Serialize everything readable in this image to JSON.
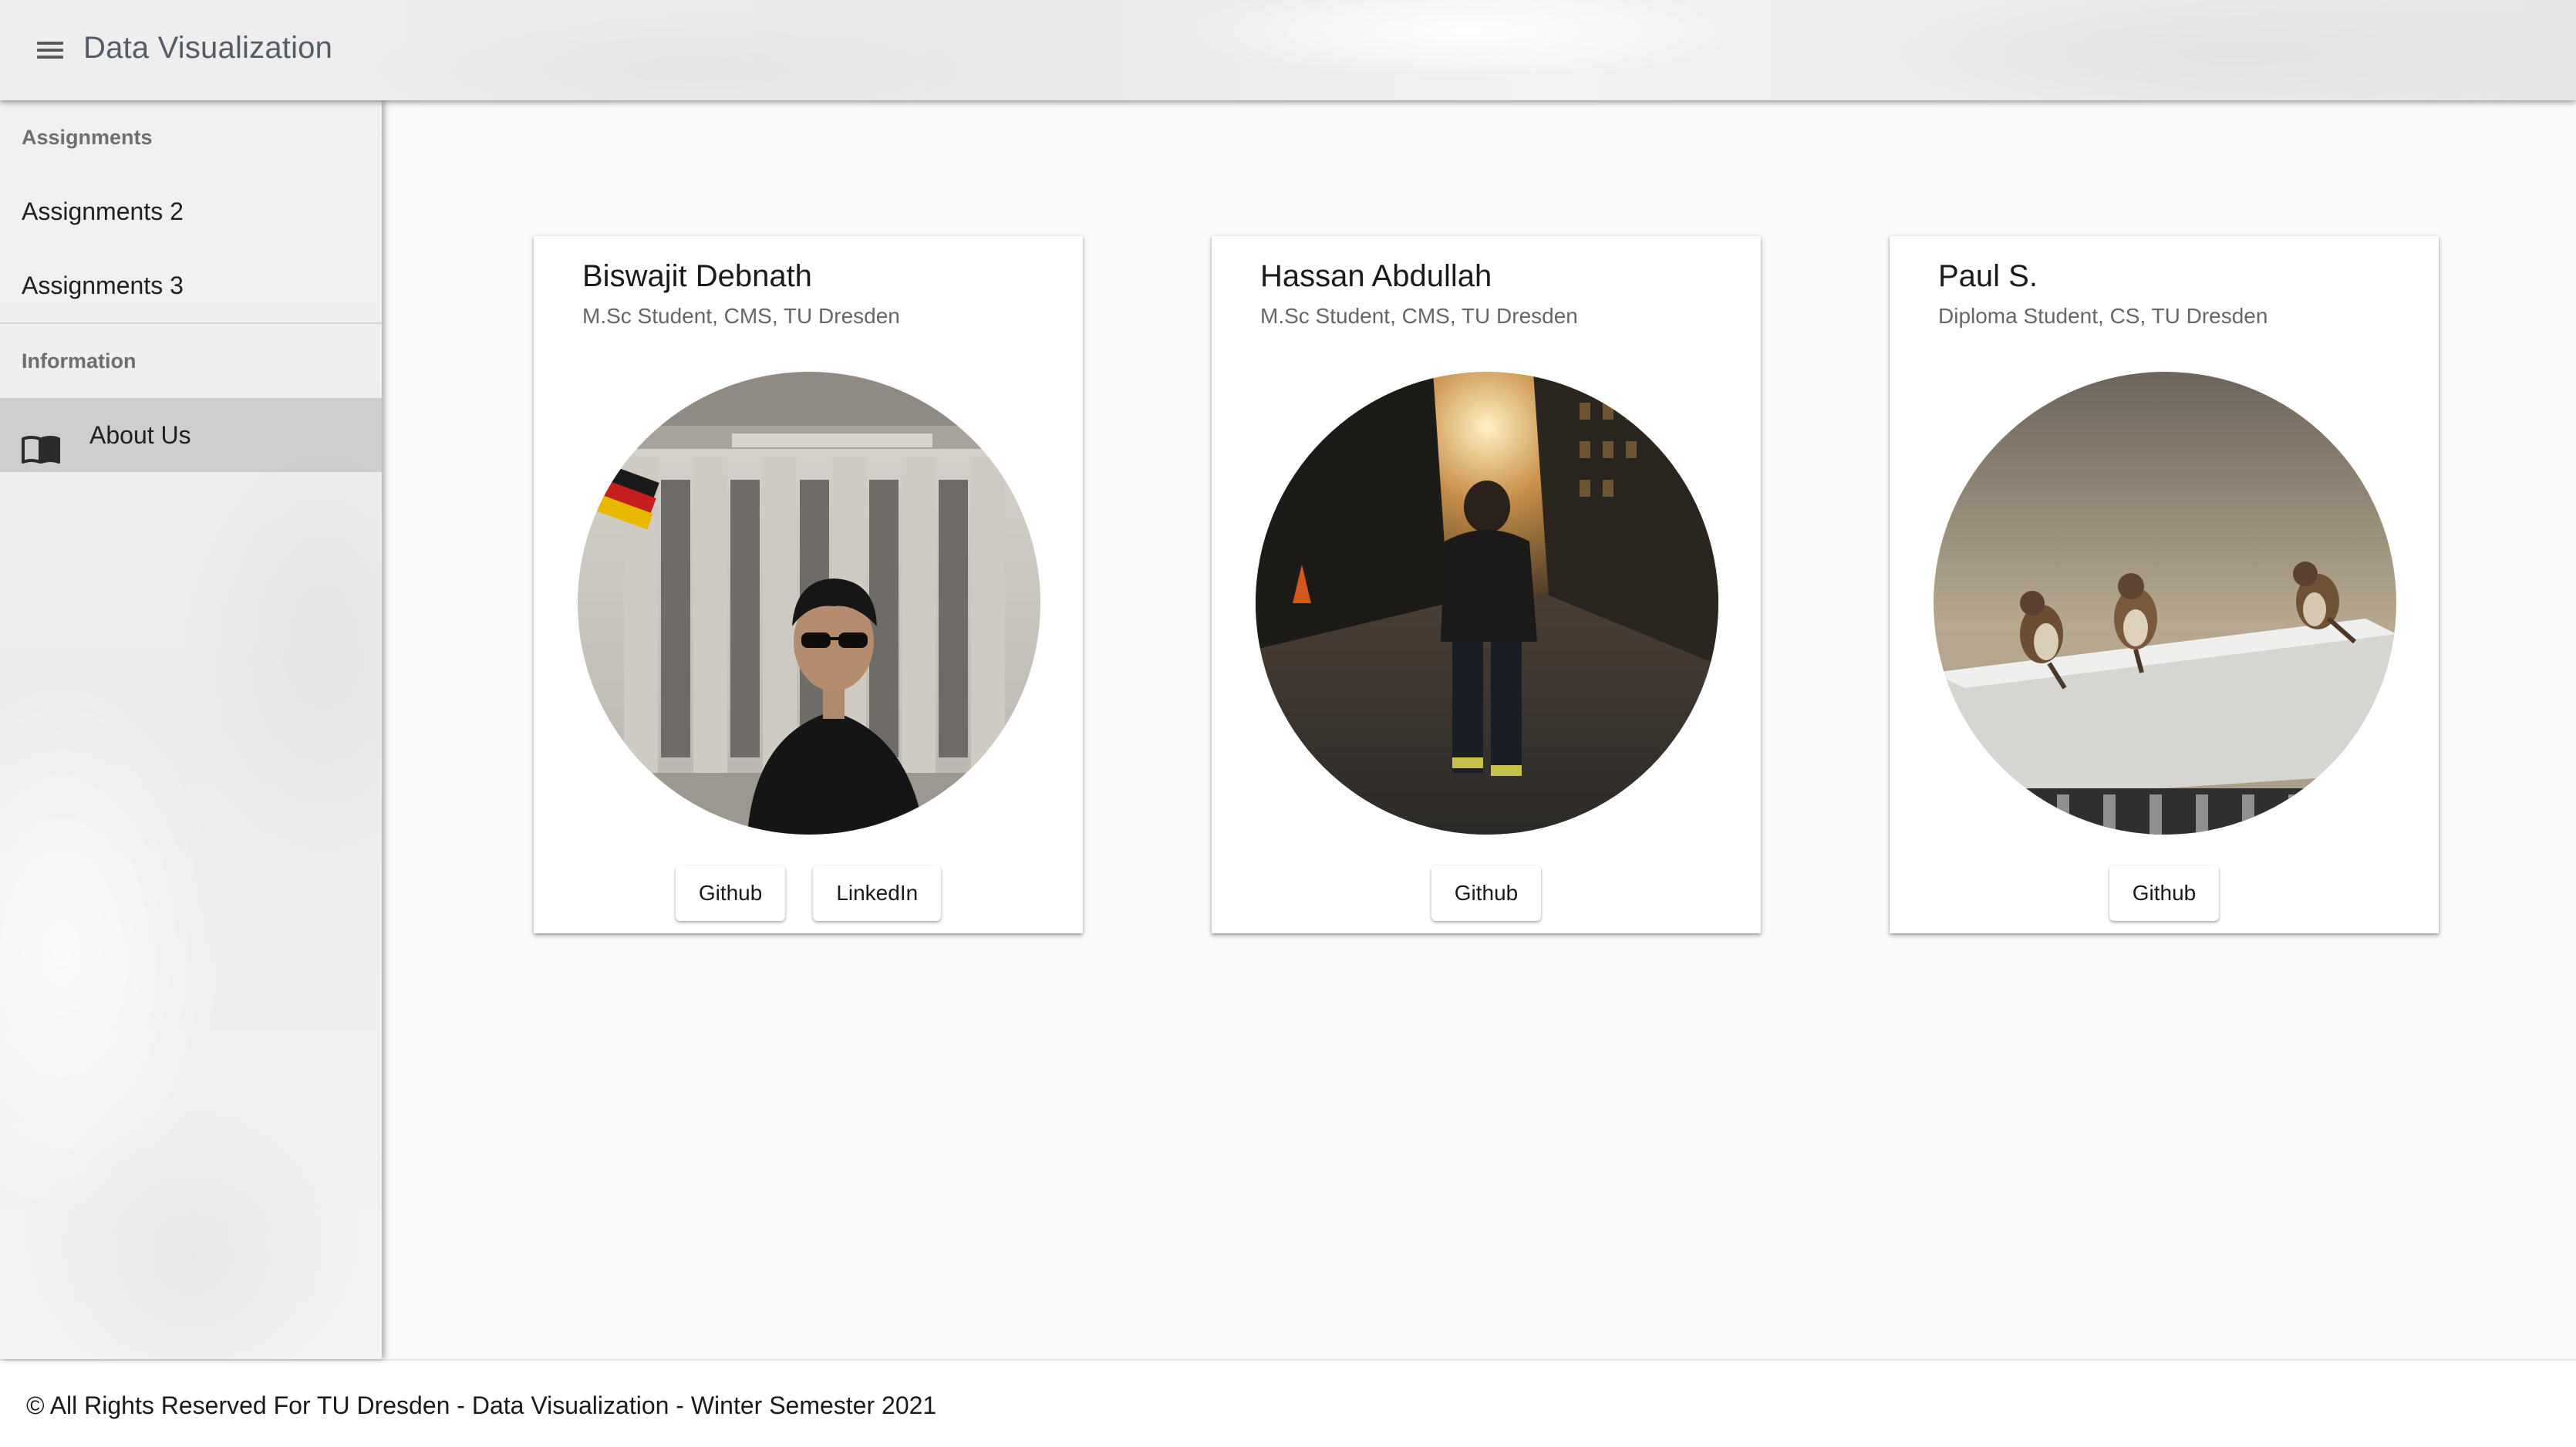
{
  "header": {
    "title": "Data Visualization",
    "menu_icon": "hamburger-menu-icon"
  },
  "sidebar": {
    "sections": [
      {
        "subheader": "Assignments",
        "items": [
          {
            "label": "Assignments 2"
          },
          {
            "label": "Assignments 3"
          }
        ]
      },
      {
        "subheader": "Information",
        "items": [
          {
            "label": "About Us",
            "icon": "book-icon",
            "active": true
          }
        ]
      }
    ]
  },
  "cards": [
    {
      "name": "Biswajit Debnath",
      "subtitle": "M.Sc Student, CMS, TU Dresden",
      "photo": "portrait in front of Reichstag building",
      "buttons": [
        "Github",
        "LinkedIn"
      ]
    },
    {
      "name": "Hassan Abdullah",
      "subtitle": "M.Sc Student, CMS, TU Dresden",
      "photo": "person walking on city street at sunset",
      "buttons": [
        "Github"
      ]
    },
    {
      "name": "Paul S.",
      "subtitle": "Diploma Student, CS, TU Dresden",
      "photo": "sparrows on stone ledge",
      "buttons": [
        "Github"
      ]
    }
  ],
  "footer": {
    "text": "© All Rights Reserved For TU Dresden - Data Visualization - Winter Semester 2021"
  },
  "colors": {
    "sidebar_active_bg": "#b4b4b4",
    "title_text": "#555c66",
    "subheader_text": "#6e6e6e"
  }
}
